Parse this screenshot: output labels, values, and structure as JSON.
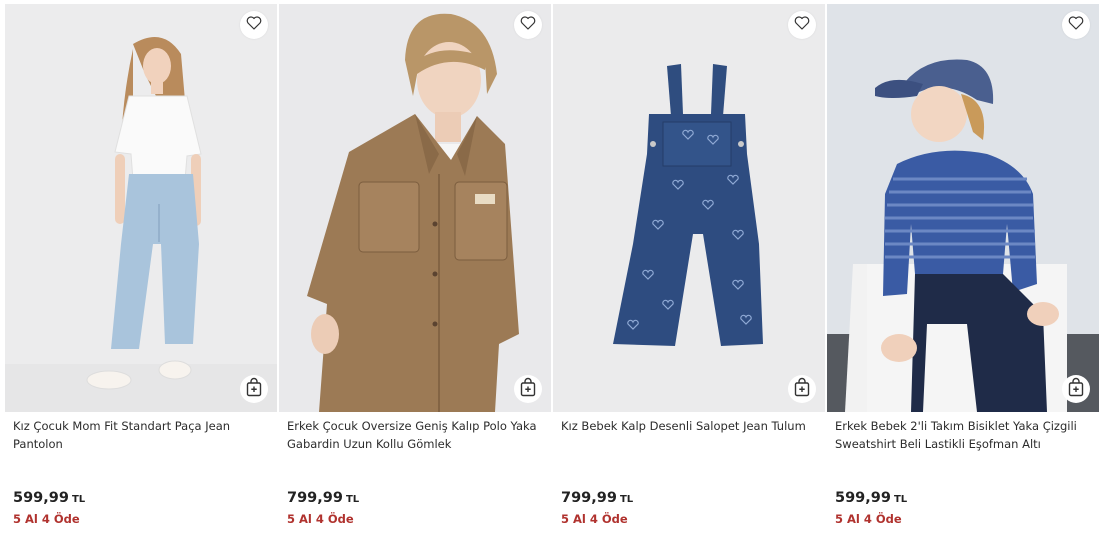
{
  "products": [
    {
      "title": "Kız Çocuk Mom Fit Standart Paça Jean Pantolon",
      "price": "599,99",
      "currency": "TL",
      "promo": "5 Al 4 Öde",
      "bg": "#ececed"
    },
    {
      "title": "Erkek Çocuk Oversize Geniş Kalıp Polo Yaka Gabardin Uzun Kollu Gömlek",
      "price": "799,99",
      "currency": "TL",
      "promo": "5 Al 4 Öde",
      "bg": "#e9e9eb"
    },
    {
      "title": "Kız Bebek Kalp Desenli Salopet Jean Tulum",
      "price": "799,99",
      "currency": "TL",
      "promo": "5 Al 4 Öde",
      "bg": "#ebebec"
    },
    {
      "title": "Erkek Bebek 2'li Takım Bisiklet Yaka Çizgili Sweatshirt Beli Lastikli Eşofman Altı",
      "price": "599,99",
      "currency": "TL",
      "promo": "5 Al 4 Öde",
      "bg": "#dfe3e8"
    }
  ],
  "icons": {
    "favorite": "heart-outline-icon",
    "add_to_cart": "shopping-bag-plus-icon"
  },
  "colors": {
    "promo": "#b0322e",
    "price": "#222222"
  }
}
